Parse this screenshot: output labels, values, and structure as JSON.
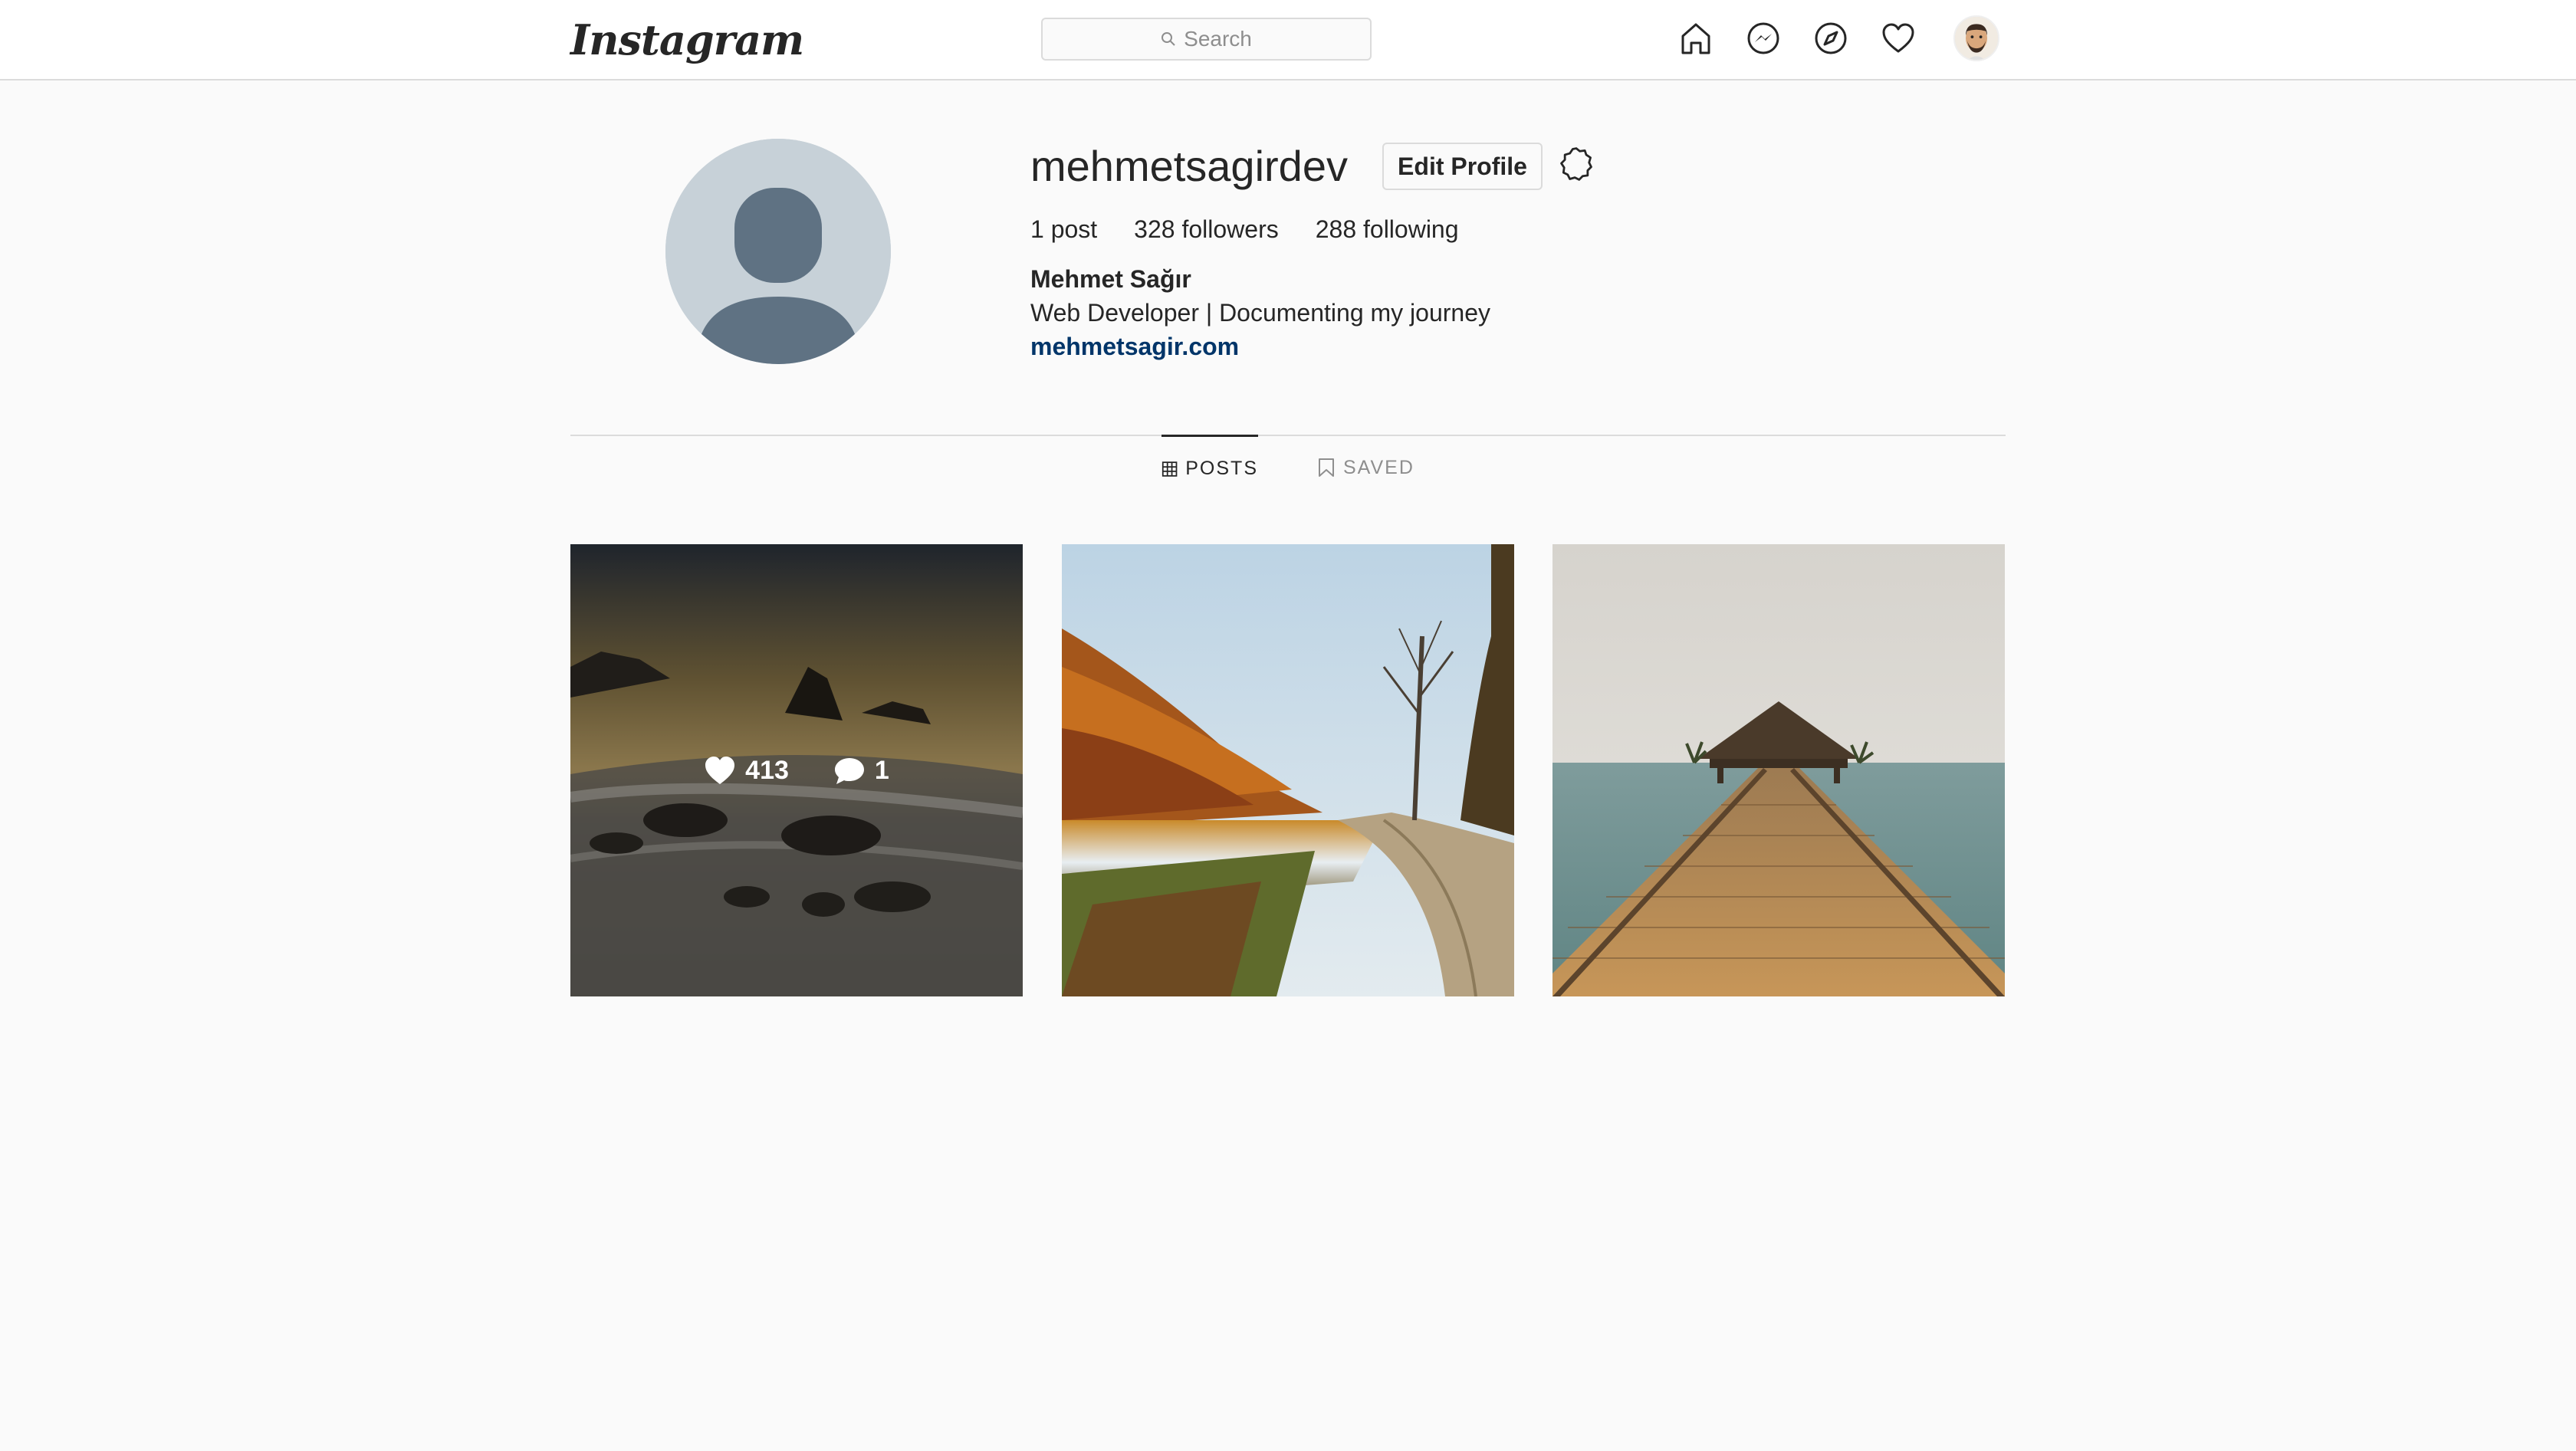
{
  "header": {
    "logo_text": "Instagram",
    "search_placeholder": "Search",
    "nav_icons": [
      "home-icon",
      "messenger-icon",
      "explore-icon",
      "activity-heart-icon",
      "profile-avatar"
    ]
  },
  "profile": {
    "username": "mehmetsagirdev",
    "edit_button_label": "Edit Profile",
    "stats": [
      {
        "value": "1",
        "label": "post"
      },
      {
        "value": "328",
        "label": "followers"
      },
      {
        "value": "288",
        "label": "following"
      }
    ],
    "full_name": "Mehmet Sağır",
    "bio": "Web Developer | Documenting my journey",
    "website": "mehmetsagir.com"
  },
  "tabs": [
    {
      "label": "POSTS",
      "active": true
    },
    {
      "label": "SAVED",
      "active": false
    }
  ],
  "posts": [
    {
      "description": "rocky beach long exposure",
      "likes": "413",
      "comments": "1",
      "hovered": true
    },
    {
      "description": "autumn lake with road",
      "hovered": false
    },
    {
      "description": "wooden pier to gazebo",
      "hovered": false
    }
  ],
  "colors": {
    "background": "#fafafa",
    "border": "#dbdbdb",
    "link": "#003569",
    "muted": "#8e8e8e"
  }
}
